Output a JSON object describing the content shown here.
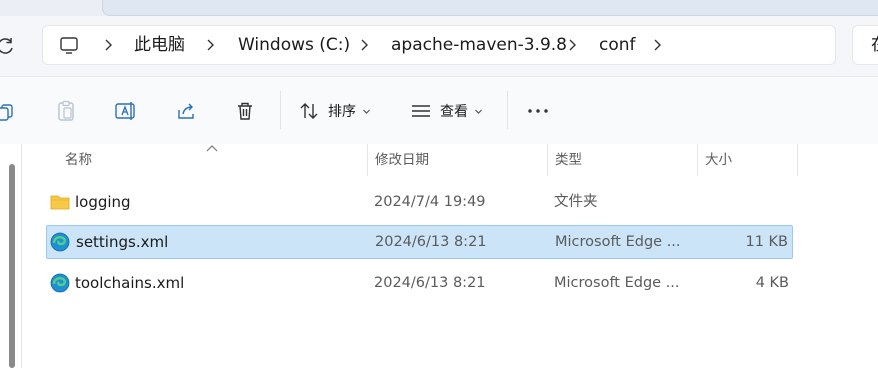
{
  "address": {
    "breadcrumbs": [
      "此电脑",
      "Windows (C:)",
      "apache-maven-3.9.8",
      "conf"
    ],
    "search_placeholder": "在"
  },
  "toolbar": {
    "sort_label": "排序",
    "view_label": "查看",
    "more_label": "•••"
  },
  "columns": {
    "name": "名称",
    "modified": "修改日期",
    "type": "类型",
    "size": "大小"
  },
  "files": [
    {
      "name": "logging",
      "modified": "2024/7/4 19:49",
      "type": "文件夹",
      "size": "",
      "icon": "folder-icon",
      "selected": false
    },
    {
      "name": "settings.xml",
      "modified": "2024/6/13 8:21",
      "type": "Microsoft Edge ...",
      "size": "11 KB",
      "icon": "edge-icon",
      "selected": true
    },
    {
      "name": "toolchains.xml",
      "modified": "2024/6/13 8:21",
      "type": "Microsoft Edge ...",
      "size": "4 KB",
      "icon": "edge-icon",
      "selected": false
    }
  ],
  "colors": {
    "selection_bg": "#cce4f7",
    "selection_border": "#99c9ef",
    "folder": "#f7c948"
  }
}
